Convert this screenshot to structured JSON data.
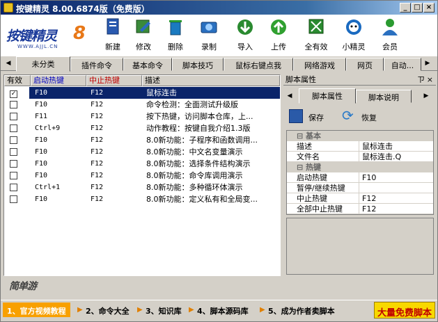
{
  "window": {
    "title": "按键精灵 8.00.6874版（免费版）"
  },
  "logo": {
    "text": "按键精灵",
    "num": "8",
    "url": "WWW.AJJL.CN"
  },
  "toolbar": [
    {
      "label": "新建",
      "icon": "new-doc-icon",
      "color": "#1f5fa8"
    },
    {
      "label": "修改",
      "icon": "edit-icon",
      "color": "#2a7a2a"
    },
    {
      "label": "删除",
      "icon": "trash-icon",
      "color": "#1a6aa0"
    },
    {
      "label": "录制",
      "icon": "camera-icon",
      "color": "#2a70c0"
    },
    {
      "label": "导入",
      "icon": "import-icon",
      "color": "#2a8a30"
    },
    {
      "label": "上传",
      "icon": "upload-icon",
      "color": "#30a030"
    },
    {
      "label": "全有效",
      "icon": "check-all-icon",
      "color": "#2a8a30"
    },
    {
      "label": "小精灵",
      "icon": "sprite-icon",
      "color": "#1a6ac0"
    },
    {
      "label": "会员",
      "icon": "member-icon",
      "color": "#2a9a30"
    }
  ],
  "tabs": [
    "未分类",
    "插件命令",
    "基本命令",
    "脚本技巧",
    "鼠标右键点我",
    "网络游戏",
    "网页",
    "自动..."
  ],
  "list": {
    "headers": [
      "有效",
      "启动热键",
      "中止热键",
      "描述"
    ],
    "rows": [
      {
        "checked": true,
        "start": "F10",
        "stop": "F12",
        "desc": "鼠标连击"
      },
      {
        "checked": false,
        "start": "F10",
        "stop": "F12",
        "desc": "命令检测：全面测试升级版"
      },
      {
        "checked": false,
        "start": "F11",
        "stop": "F12",
        "desc": "按下热键，访问脚本仓库，上..."
      },
      {
        "checked": false,
        "start": "Ctrl+9",
        "stop": "F12",
        "desc": "动作教程：按键自我介绍1.3版"
      },
      {
        "checked": false,
        "start": "F10",
        "stop": "F12",
        "desc": "8.0新功能：子程序和函数调用..."
      },
      {
        "checked": false,
        "start": "F10",
        "stop": "F12",
        "desc": "8.0新功能：中文名变量演示"
      },
      {
        "checked": false,
        "start": "F10",
        "stop": "F12",
        "desc": "8.0新功能：选择条件结构演示"
      },
      {
        "checked": false,
        "start": "F10",
        "stop": "F12",
        "desc": "8.0新功能：命令库调用演示"
      },
      {
        "checked": false,
        "start": "Ctrl+1",
        "stop": "F12",
        "desc": "8.0新功能：多种循环体演示"
      },
      {
        "checked": false,
        "start": "F10",
        "stop": "F12",
        "desc": "8.0新功能：定义私有和全局变..."
      }
    ]
  },
  "right": {
    "title": "脚本属性",
    "pin": "ㄗ",
    "close": "×",
    "tabs": [
      "脚本属性",
      "脚本说明"
    ],
    "save": "保存",
    "restore": "恢复",
    "groups": {
      "basic": "基本",
      "hotkey": "热键"
    },
    "props_basic": [
      {
        "k": "描述",
        "v": "鼠标连击"
      },
      {
        "k": "文件名",
        "v": "鼠标连击.Q"
      }
    ],
    "props_hotkey": [
      {
        "k": "启动热键",
        "v": "F10"
      },
      {
        "k": "暂停/继续热键",
        "v": ""
      },
      {
        "k": "中止热键",
        "v": "F12"
      },
      {
        "k": "全部中止热键",
        "v": "F12"
      }
    ]
  },
  "brand2": "简单游",
  "bottom": [
    "1、官方视频教程",
    "2、命令大全",
    "3、知识库",
    "4、脚本源码库",
    "5、成为作者卖脚本"
  ],
  "ad": "大量免费脚本"
}
